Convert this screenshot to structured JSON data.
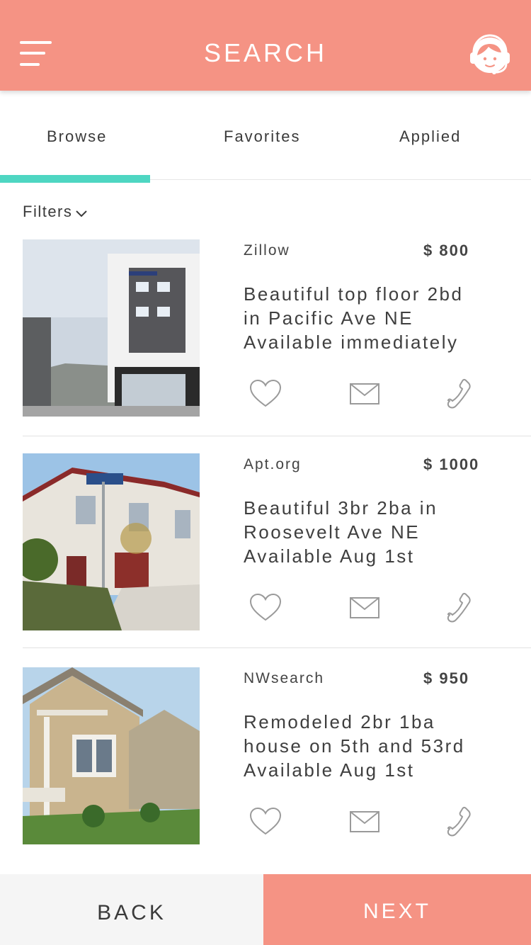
{
  "header": {
    "title": "SEARCH",
    "menu_icon": "hamburger-menu-icon",
    "support_icon": "support-agent-icon"
  },
  "tabs": [
    {
      "label": "Browse",
      "active": true
    },
    {
      "label": "Favorites",
      "active": false
    },
    {
      "label": "Applied",
      "active": false
    }
  ],
  "filters": {
    "label": "Filters",
    "icon": "chevron-down-icon"
  },
  "listings": [
    {
      "source": "Zillow",
      "price": "$ 800",
      "desc": [
        "Beautiful top floor 2bd",
        "in Pacific Ave NE",
        "Available immediately"
      ],
      "photo": "modern apartment building photo"
    },
    {
      "source": "Apt.org",
      "price": "$ 1000",
      "desc": [
        "Beautiful 3br 2ba in",
        "Roosevelt Ave NE",
        "Available Aug 1st"
      ],
      "photo": "townhouse on Habitat Way photo"
    },
    {
      "source": "NWsearch",
      "price": "$ 950",
      "desc": [
        "Remodeled 2br 1ba",
        "house on 5th and 53rd",
        "Available Aug 1st"
      ],
      "photo": "craftsman house photo"
    }
  ],
  "footer": {
    "back_label": "BACK",
    "next_label": "NEXT"
  },
  "colors": {
    "brand": "#f59384",
    "accent": "#4ed6c2",
    "icon": "#9a9a9a"
  }
}
